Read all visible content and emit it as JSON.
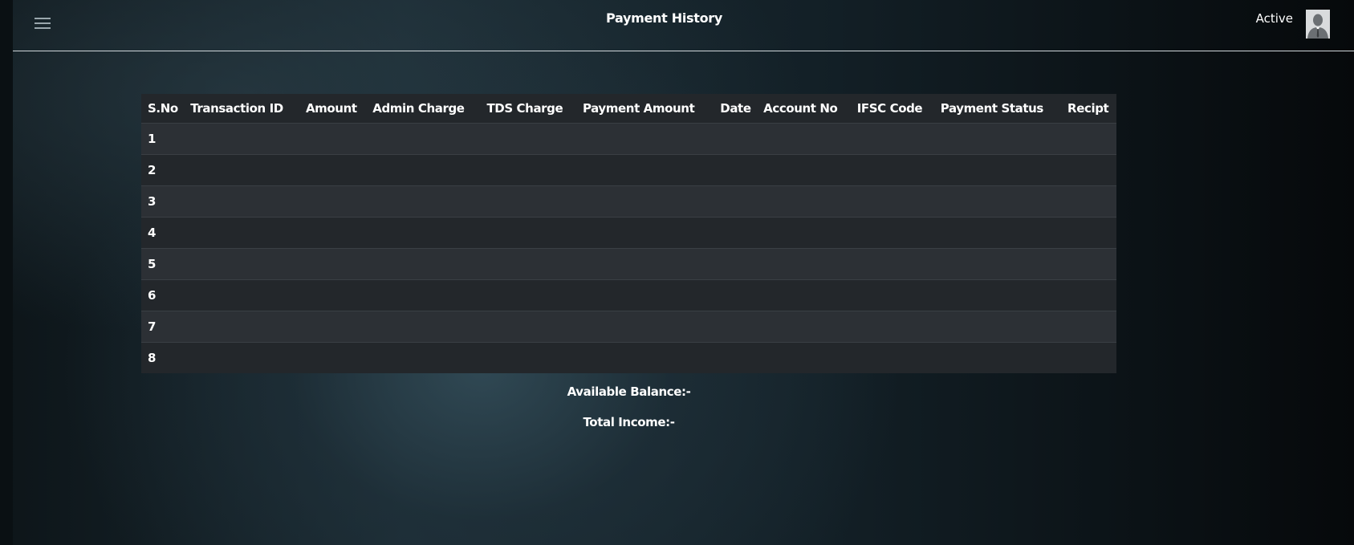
{
  "header": {
    "title": "Payment History",
    "status": "Active"
  },
  "table": {
    "columns": [
      "S.No",
      "Transaction ID",
      "Amount",
      "Admin Charge",
      "TDS Charge",
      "Payment Amount",
      "Date",
      "Account No",
      "IFSC Code",
      "Payment Status",
      "Recipt"
    ],
    "rows": [
      {
        "sno": "1"
      },
      {
        "sno": "2"
      },
      {
        "sno": "3"
      },
      {
        "sno": "4"
      },
      {
        "sno": "5"
      },
      {
        "sno": "6"
      },
      {
        "sno": "7"
      },
      {
        "sno": "8"
      }
    ]
  },
  "summary": {
    "available_balance": "Available Balance:-",
    "total_income": "Total Income:-"
  }
}
